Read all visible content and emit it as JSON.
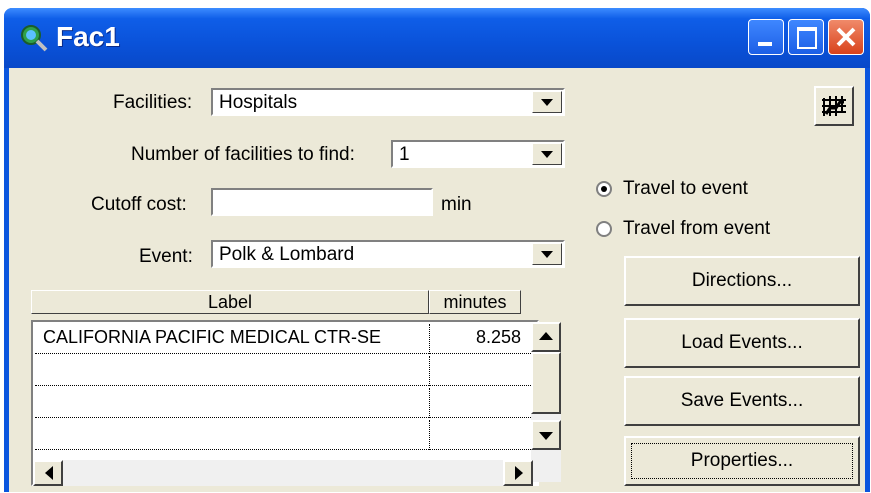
{
  "window": {
    "title": "Fac1",
    "icon": "magnifier-globe-icon"
  },
  "form": {
    "facilities_label": "Facilities:",
    "facilities_value": "Hospitals",
    "num_facilities_label": "Number of facilities to find:",
    "num_facilities_value": "1",
    "cutoff_label": "Cutoff cost:",
    "cutoff_value": "",
    "cutoff_unit": "min",
    "event_label": "Event:",
    "event_value": "Polk & Lombard"
  },
  "radios": [
    {
      "label": "Travel to event",
      "checked": true
    },
    {
      "label": "Travel from event",
      "checked": false
    }
  ],
  "buttons": {
    "directions": "Directions...",
    "load_events": "Load Events...",
    "save_events": "Save Events...",
    "properties": "Properties..."
  },
  "table": {
    "columns": [
      "Label",
      "minutes"
    ],
    "rows": [
      {
        "label": "CALIFORNIA PACIFIC MEDICAL CTR-SE",
        "minutes": "8.258"
      },
      {
        "label": "",
        "minutes": ""
      },
      {
        "label": "",
        "minutes": ""
      },
      {
        "label": "",
        "minutes": ""
      }
    ]
  }
}
